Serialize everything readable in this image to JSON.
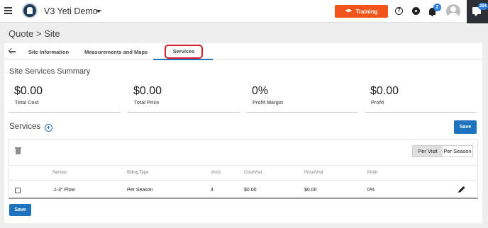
{
  "header": {
    "app_name": "V3 Yeti Demo",
    "training_label": "Training",
    "notification_count": "2",
    "chat_count": "294"
  },
  "breadcrumb": "Quote > Site",
  "tabs": {
    "items": [
      {
        "label": "Site Information"
      },
      {
        "label": "Measurements and Maps"
      },
      {
        "label": "Services"
      }
    ],
    "active": "Services"
  },
  "summary": {
    "title": "Site Services Summary",
    "metrics": [
      {
        "value": "$0.00",
        "label": "Total Cost"
      },
      {
        "value": "$0.00",
        "label": "Total Price"
      },
      {
        "value": "0%",
        "label": "Profit Margin"
      },
      {
        "value": "$0.00",
        "label": "Profit"
      }
    ]
  },
  "services": {
    "title": "Services",
    "save_label": "Save",
    "toggle": {
      "options": [
        "Per Visit",
        "Per Season"
      ],
      "selected": "Per Visit"
    },
    "columns": [
      "Service",
      "Billing Type",
      "Visits",
      "Cost/Visit",
      "Price/Visit",
      "Profit"
    ],
    "rows": [
      {
        "service": ".1-3\" Plow",
        "billing_type": "Per Season",
        "visits": "4",
        "cost_visit": "$0.00",
        "price_visit": "$0.00",
        "profit": "0%"
      }
    ],
    "bottom_save_label": "Save"
  },
  "colors": {
    "accent": "#1e73be",
    "training": "#f2541b",
    "highlight": "#d42027"
  }
}
